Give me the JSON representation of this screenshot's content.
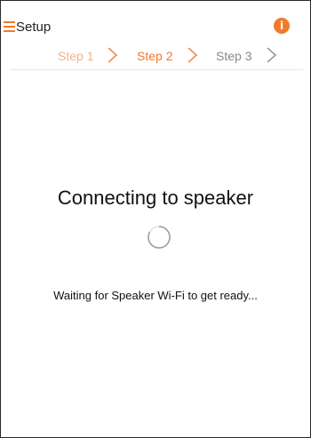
{
  "header": {
    "title": "Setup",
    "menu_icon": "hamburger-menu-icon",
    "info_icon": "info-icon",
    "info_glyph": "i"
  },
  "steps": [
    {
      "label": "Step 1",
      "state": "completed"
    },
    {
      "label": "Step 2",
      "state": "current"
    },
    {
      "label": "Step 3",
      "state": "upcoming"
    }
  ],
  "main": {
    "heading": "Connecting to speaker",
    "spinner_icon": "loading-spinner-icon",
    "status": "Waiting for Speaker Wi-Fi to get ready..."
  },
  "colors": {
    "accent": "#f07a2c",
    "step_completed": "#f4b08a",
    "step_upcoming": "#888888",
    "text": "#111111"
  }
}
